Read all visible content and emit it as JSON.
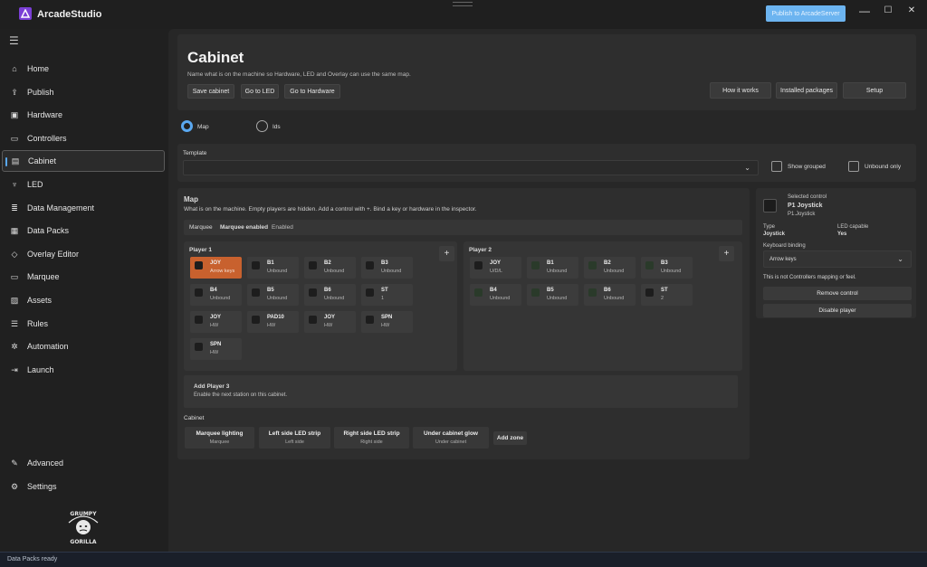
{
  "app": {
    "title": "ArcadeStudio",
    "publish_label": "Publish to ArcadeServer"
  },
  "window": {
    "minimize": "—",
    "maximize": "☐",
    "close": "✕"
  },
  "sidebar": {
    "items": [
      {
        "label": "Home",
        "icon": "home-icon"
      },
      {
        "label": "Publish",
        "icon": "publish-icon"
      },
      {
        "label": "Hardware",
        "icon": "chip-icon"
      },
      {
        "label": "Controllers",
        "icon": "controller-icon"
      },
      {
        "label": "Cabinet",
        "icon": "cabinet-icon"
      },
      {
        "label": "LED",
        "icon": "led-icon"
      },
      {
        "label": "Data Management",
        "icon": "database-icon"
      },
      {
        "label": "Data Packs",
        "icon": "datapack-icon"
      },
      {
        "label": "Overlay Editor",
        "icon": "overlay-icon"
      },
      {
        "label": "Marquee",
        "icon": "marquee-icon"
      },
      {
        "label": "Assets",
        "icon": "assets-icon"
      },
      {
        "label": "Rules",
        "icon": "rules-icon"
      },
      {
        "label": "Automation",
        "icon": "automation-icon"
      },
      {
        "label": "Launch",
        "icon": "launch-icon"
      }
    ],
    "bottom": [
      {
        "label": "Advanced",
        "icon": "wrench-icon"
      },
      {
        "label": "Settings",
        "icon": "gear-icon"
      }
    ],
    "logo_text": [
      "GRUMPY",
      "GORILLA"
    ]
  },
  "status": {
    "text": "Data Packs ready"
  },
  "header": {
    "title": "Cabinet",
    "subtitle": "Name what is on the machine so Hardware, LED and Overlay can use the same map.",
    "buttons": [
      "Save cabinet",
      "Go to LED",
      "Go to Hardware"
    ],
    "right_buttons": [
      "How it works",
      "Installed packages",
      "Setup"
    ]
  },
  "view_mode": {
    "options": [
      "Map",
      "Ids"
    ],
    "selected": "Map"
  },
  "template": {
    "label": "Template",
    "value": "",
    "show_grouped": "Show grouped",
    "unbound_only": "Unbound only"
  },
  "map": {
    "title": "Map",
    "subtitle": "What is on the machine. Empty players are hidden. Add a control with +. Bind a key or hardware in the inspector.",
    "marquee": {
      "label": "Marquee",
      "state": "Marquee enabled",
      "detail": "Enabled"
    },
    "players": [
      {
        "name": "Player 1",
        "tiles": [
          {
            "label": "JOY",
            "sub": "Arrow keys",
            "selected": true
          },
          {
            "label": "B1",
            "sub": "Unbound"
          },
          {
            "label": "B2",
            "sub": "Unbound"
          },
          {
            "label": "B3",
            "sub": "Unbound"
          },
          {
            "label": "B4",
            "sub": "Unbound"
          },
          {
            "label": "B5",
            "sub": "Unbound"
          },
          {
            "label": "B6",
            "sub": "Unbound"
          },
          {
            "label": "ST",
            "sub": "1"
          },
          {
            "label": "JOY",
            "sub": "HW"
          },
          {
            "label": "PAD10",
            "sub": "HW"
          },
          {
            "label": "JOY",
            "sub": "HW"
          },
          {
            "label": "SPN",
            "sub": "HW"
          },
          {
            "label": "SPN",
            "sub": "HW"
          }
        ]
      },
      {
        "name": "Player 2",
        "tiles": [
          {
            "label": "JOY",
            "sub": "U/D/L"
          },
          {
            "label": "B1",
            "sub": "Unbound"
          },
          {
            "label": "B2",
            "sub": "Unbound"
          },
          {
            "label": "B3",
            "sub": "Unbound"
          },
          {
            "label": "B4",
            "sub": "Unbound"
          },
          {
            "label": "B5",
            "sub": "Unbound"
          },
          {
            "label": "B6",
            "sub": "Unbound"
          },
          {
            "label": "ST",
            "sub": "2"
          }
        ]
      }
    ],
    "add_player": {
      "title": "Add Player 3",
      "subtitle": "Enable the next station on this cabinet."
    },
    "cabinet": {
      "label": "Cabinet",
      "zones": [
        {
          "title": "Marquee lighting",
          "sub": "Marquee"
        },
        {
          "title": "Left side LED strip",
          "sub": "Left side"
        },
        {
          "title": "Right side LED strip",
          "sub": "Right side"
        },
        {
          "title": "Under cabinet glow",
          "sub": "Under cabinet"
        }
      ],
      "add_zone": "Add zone"
    }
  },
  "inspector": {
    "selected_label": "Selected control",
    "name": "P1 Joystick",
    "id": "P1.Joystick",
    "type_label": "Type",
    "type_value": "Joystick",
    "led_label": "LED capable",
    "led_value": "Yes",
    "binding_label": "Keyboard binding",
    "binding_value": "Arrow keys",
    "note": "This is not Controllers mapping or feel.",
    "remove": "Remove control",
    "disable": "Disable player"
  }
}
